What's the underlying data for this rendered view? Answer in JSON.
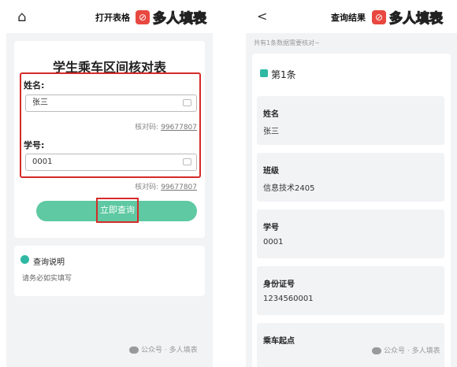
{
  "left_screen": {
    "header": {
      "home_icon": "home-icon",
      "title": "打开表格",
      "brand_name": "多人填表",
      "brand_logo_glyph": "⊘"
    },
    "form": {
      "title": "学生乘车区间核对表",
      "fields": [
        {
          "label": "姓名:",
          "value": "张三",
          "verify_label": "核对码:",
          "verify_code": "99677807"
        },
        {
          "label": "学号:",
          "value": "0001",
          "verify_label": "核对码:",
          "verify_code": "99677807"
        }
      ],
      "submit_label": "立即查询"
    },
    "note": {
      "title": "查询说明",
      "text": "请务必如实填写"
    },
    "footer": "公众号 · 多人填表"
  },
  "right_screen": {
    "header": {
      "back_icon": "back-icon",
      "title": "查询结果",
      "brand_name": "多人填表",
      "brand_logo_glyph": "⊘"
    },
    "summary": "共有1条数据需要核对~",
    "record_title": "第1条",
    "fields": [
      {
        "key": "姓名",
        "value": "张三"
      },
      {
        "key": "班级",
        "value": "信息技术2405"
      },
      {
        "key": "学号",
        "value": "0001"
      },
      {
        "key": "身份证号",
        "value": "1234560001"
      },
      {
        "key": "乘车起点",
        "value": ""
      }
    ],
    "footer": "公众号 · 多人填表"
  },
  "colors": {
    "accent": "#5ec9a3",
    "highlight_border": "#d62b28",
    "icon_teal": "#2fb9a4",
    "brand_red": "#e8483f"
  }
}
